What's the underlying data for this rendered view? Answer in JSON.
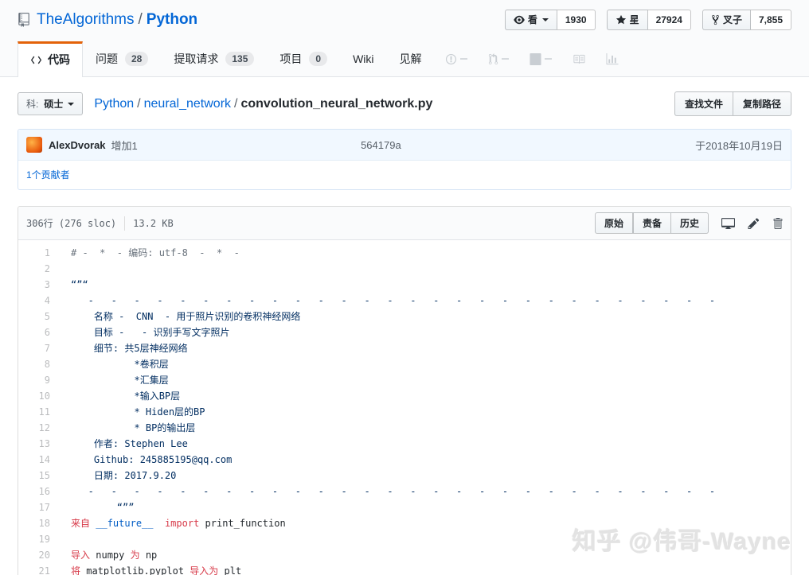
{
  "header": {
    "repo_owner": "TheAlgorithms",
    "repo_sep": "/",
    "repo_name": "Python",
    "social": [
      {
        "icon": "eye-icon",
        "label": "看",
        "count": "1930",
        "has_caret": true
      },
      {
        "icon": "star-icon",
        "label": "星",
        "count": "27924",
        "has_caret": false
      },
      {
        "icon": "fork-icon",
        "label": "叉子",
        "count": "7,855",
        "has_caret": false
      }
    ]
  },
  "tabs": [
    {
      "label": "代码",
      "active": true,
      "icon": "code-icon"
    },
    {
      "label": "问题",
      "count": "28"
    },
    {
      "label": "提取请求",
      "count": "135"
    },
    {
      "label": "项目",
      "count": "0"
    },
    {
      "label": "Wiki"
    },
    {
      "label": "见解"
    }
  ],
  "tab_icons": [
    {
      "name": "issue-alert-icon",
      "dash": true
    },
    {
      "name": "pull-request-icon",
      "dash": true
    },
    {
      "name": "project-board-icon",
      "dash": true
    },
    {
      "name": "book-icon",
      "dash": false
    },
    {
      "name": "graph-icon",
      "dash": false
    }
  ],
  "file_nav": {
    "branch_prefix": "科:",
    "branch_name": "硕士",
    "sep": "/",
    "breadcrumb": [
      {
        "label": "Python",
        "link": true
      },
      {
        "label": "neural_network",
        "link": true
      },
      {
        "label": "convolution_neural_network.py",
        "link": false
      }
    ],
    "buttons": [
      "查找文件",
      "复制路径"
    ]
  },
  "commit": {
    "author": "AlexDvorak",
    "message": "增加1",
    "hash": "564179a",
    "date": "于2018年10月19日",
    "contributors": "1个贡献者"
  },
  "file": {
    "lines_info": "306行 (276 sloc)",
    "size": "13.2 KB",
    "buttons": [
      "原始",
      "责备",
      "历史"
    ],
    "icons": [
      "display-icon",
      "pencil-icon",
      "trash-icon"
    ]
  },
  "code": {
    "lines": [
      {
        "n": "1",
        "tokens": [
          {
            "c": "c",
            "t": "# -  *  - 编码: utf-8  -  *  -"
          }
        ]
      },
      {
        "n": "2",
        "tokens": []
      },
      {
        "n": "3",
        "tokens": [
          {
            "c": "s",
            "t": "“”“"
          }
        ]
      },
      {
        "n": "4",
        "tokens": [
          {
            "c": "s",
            "t": "   -   -   -   -   -   -   -   -   -   -   -   -   -   -   -   -   -   -   -   -   -   -   -   -   -   -   -   -"
          }
        ]
      },
      {
        "n": "5",
        "tokens": [
          {
            "c": "s",
            "t": "    名称 -  CNN  - 用于照片识别的卷积神经网络"
          }
        ]
      },
      {
        "n": "6",
        "tokens": [
          {
            "c": "s",
            "t": "    目标 -   - 识别手写文字照片"
          }
        ]
      },
      {
        "n": "7",
        "tokens": [
          {
            "c": "s",
            "t": "    细节: 共5层神经网络"
          }
        ]
      },
      {
        "n": "8",
        "tokens": [
          {
            "c": "s",
            "t": "           *卷积层"
          }
        ]
      },
      {
        "n": "9",
        "tokens": [
          {
            "c": "s",
            "t": "           *汇集层"
          }
        ]
      },
      {
        "n": "10",
        "tokens": [
          {
            "c": "s",
            "t": "           *输入BP层"
          }
        ]
      },
      {
        "n": "11",
        "tokens": [
          {
            "c": "s",
            "t": "           * Hiden层的BP"
          }
        ]
      },
      {
        "n": "12",
        "tokens": [
          {
            "c": "s",
            "t": "           * BP的输出层"
          }
        ]
      },
      {
        "n": "13",
        "tokens": [
          {
            "c": "s",
            "t": "    作者: Stephen Lee"
          }
        ]
      },
      {
        "n": "14",
        "tokens": [
          {
            "c": "s",
            "t": "    Github: 245885195@qq.com"
          }
        ]
      },
      {
        "n": "15",
        "tokens": [
          {
            "c": "s",
            "t": "    日期: 2017.9.20"
          }
        ]
      },
      {
        "n": "16",
        "tokens": [
          {
            "c": "s",
            "t": "   -   -   -   -   -   -   -   -   -   -   -   -   -   -   -   -   -   -   -   -   -   -   -   -   -   -   -   -"
          }
        ]
      },
      {
        "n": "17",
        "tokens": [
          {
            "c": "s",
            "t": "        “””"
          }
        ]
      },
      {
        "n": "18",
        "tokens": [
          {
            "c": "k",
            "t": "来自"
          },
          {
            "c": "t",
            "t": " "
          },
          {
            "c": "v",
            "t": "__future__"
          },
          {
            "c": "t",
            "t": "  "
          },
          {
            "c": "k",
            "t": "import"
          },
          {
            "c": "t",
            "t": " print_function"
          }
        ]
      },
      {
        "n": "19",
        "tokens": []
      },
      {
        "n": "20",
        "tokens": [
          {
            "c": "k",
            "t": "导入"
          },
          {
            "c": "t",
            "t": " numpy "
          },
          {
            "c": "k",
            "t": "为"
          },
          {
            "c": "t",
            "t": " np"
          }
        ]
      },
      {
        "n": "21",
        "tokens": [
          {
            "c": "k",
            "t": "将"
          },
          {
            "c": "t",
            "t": " matplotlib.pyplot "
          },
          {
            "c": "k",
            "t": "导入为"
          },
          {
            "c": "t",
            "t": " plt"
          }
        ]
      }
    ]
  },
  "watermark": "知乎 @伟哥-Wayne",
  "colors": {
    "accent": "#e36209",
    "link": "#0366d6",
    "keyword": "#d73a49",
    "string": "#032f62",
    "constant": "#005cc5",
    "comment": "#6a737d"
  }
}
